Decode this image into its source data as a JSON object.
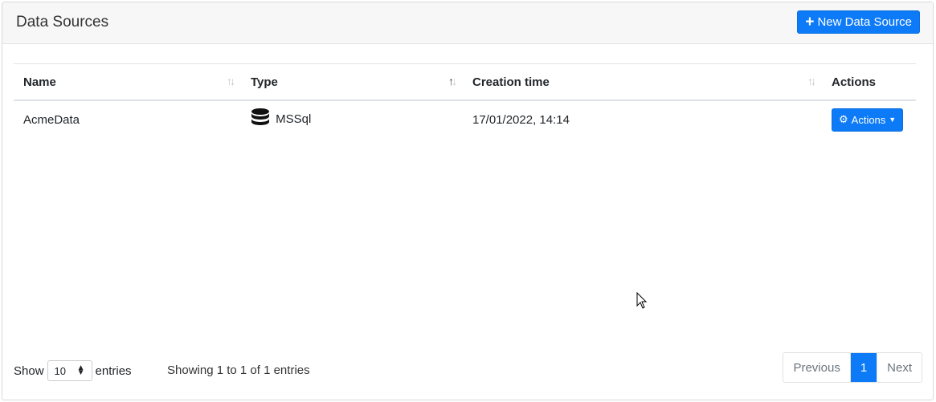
{
  "header": {
    "title": "Data Sources",
    "new_button": "New Data Source"
  },
  "table": {
    "columns": [
      "Name",
      "Type",
      "Creation time",
      "Actions"
    ],
    "rows": [
      {
        "name": "AcmeData",
        "type": "MSSql",
        "created": "17/01/2022, 14:14",
        "action": "Actions"
      }
    ]
  },
  "footer": {
    "show": "Show",
    "page_size": "10",
    "entries": "entries",
    "info": "Showing 1 to 1 of 1 entries",
    "prev": "Previous",
    "page": "1",
    "next": "Next"
  },
  "colors": {
    "accent": "#0d7af7"
  }
}
